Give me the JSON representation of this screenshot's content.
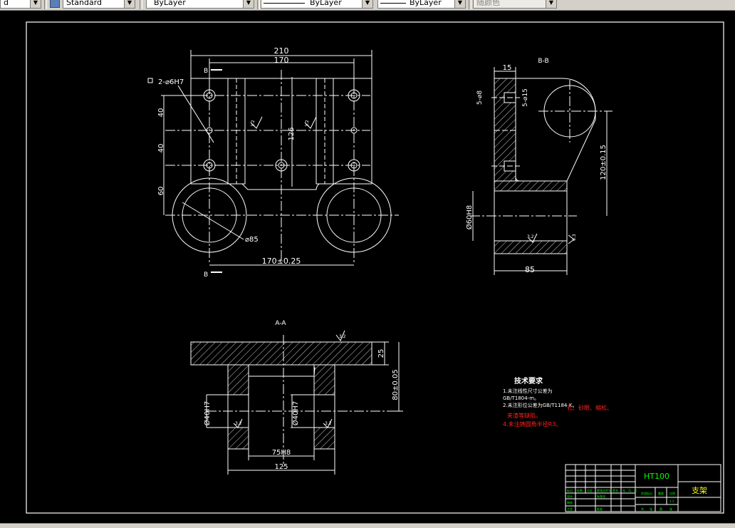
{
  "toolbar": {
    "text_style_left": "d",
    "text_style": "Standard",
    "layer_color": "ByLayer",
    "linetype": "ByLayer",
    "lineweight": "ByLayer",
    "plot_style": "随颜色"
  },
  "front_view": {
    "dim_210": "210",
    "dim_170_top": "170",
    "section_mark_top": "B",
    "section_mark_bottom": "B",
    "hole_note": "2-⌀6H7",
    "dim_40_a": "40",
    "dim_40_b": "40",
    "dim_60": "60",
    "dim_126": "126",
    "dim_d85": "⌀85",
    "dim_170_tol": "170±0.25",
    "roughness_a": "3.2",
    "roughness_b": "3.2"
  },
  "section_bb": {
    "title": "B-B",
    "dim_15": "15",
    "dim_5_d8": "5-⌀8",
    "dim_5_d15": "5-⌀15",
    "dim_120": "120±0.15",
    "dim_d60": "Ø60H8",
    "dim_85": "85",
    "roughness_a": "3.2",
    "roughness_b": "6.3"
  },
  "section_aa": {
    "title": "A-A",
    "dim_25": "25",
    "dim_80": "80±0.05",
    "dim_d40_left": "Ø40H7",
    "dim_d40_right": "Ø40H7",
    "dim_75": "75H8",
    "dim_125": "125",
    "roughness_top": "3.2",
    "roughness_l": "3.2",
    "roughness_r": "3.2"
  },
  "tech_notes": {
    "title": "技术要求",
    "line1": "1.未注线性尺寸公差为",
    "line2": "GB/T1804-m。",
    "line3": "2.未注形位公差为GB/T1184-K。",
    "line3_red": "孔、砂眼、缩松、",
    "line4_red": "夹渣等缺陷。",
    "line5_red": "4.未注铸圆角半径R3。"
  },
  "title_block": {
    "material": "HT100",
    "part_name": "支架",
    "c1": "标记",
    "c2": "处数",
    "c3": "分区",
    "c4": "更改文件号",
    "c5": "签名",
    "c6": "年、月、日",
    "c7": "设计",
    "c8": "标准化",
    "c9": "阶段标记",
    "c10": "重量",
    "c11": "比例",
    "c12": "1:1",
    "c13": "审核",
    "c14": "工艺",
    "c15": "批准",
    "c16": "共",
    "c17": "张",
    "c18": "第",
    "c19": "张"
  },
  "colors": {
    "background": "#000000",
    "lines": "#ffffff",
    "accent_green": "#00ff00",
    "accent_red": "#ff2020",
    "accent_yellow": "#ffff00"
  }
}
